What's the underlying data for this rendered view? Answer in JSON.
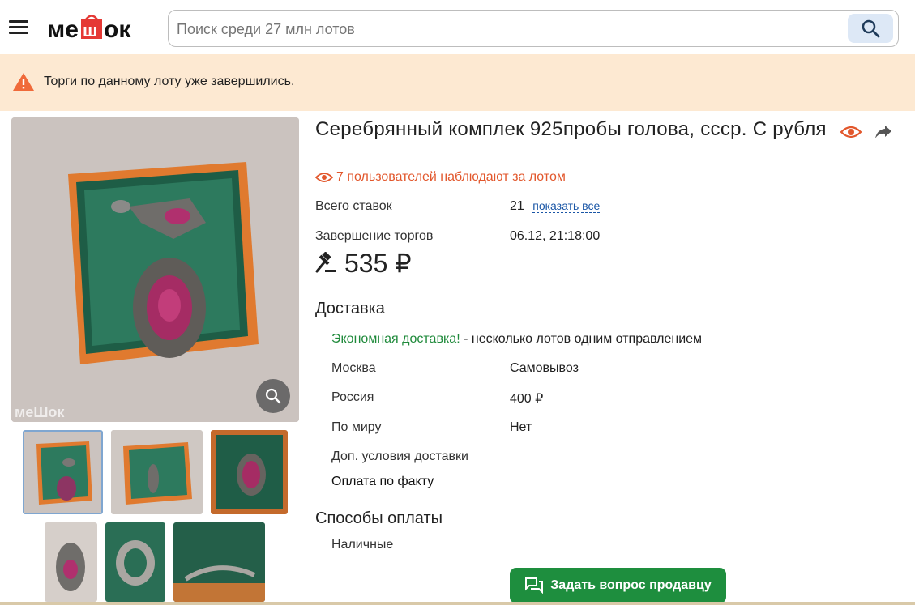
{
  "header": {
    "logo_text": "МЕШОК",
    "search_placeholder": "Поиск среди 27 млн лотов"
  },
  "notice": {
    "text": "Торги по данному лоту уже завершились."
  },
  "lot": {
    "title": "Серебрянный комплек 925пробы голова, ссср. С рубля",
    "watchers": "7 пользователей наблюдают за лотом",
    "bids_label": "Всего ставок",
    "bids_value": "21",
    "show_all": "показать все",
    "end_label": "Завершение торгов",
    "end_value": "06.12, 21:18:00",
    "price": "535 ₽"
  },
  "delivery": {
    "heading": "Доставка",
    "economy_link": "Экономная доставка!",
    "economy_text": " - несколько лотов одним отправлением",
    "rows": [
      {
        "label": "Москва",
        "value": "Самовывоз"
      },
      {
        "label": "Россия",
        "value": "400 ₽"
      },
      {
        "label": "По миру",
        "value": "Нет"
      }
    ],
    "extra_label": "Доп. условия доставки",
    "extra_value": "Оплата по факту"
  },
  "payment": {
    "heading": "Способы оплаты",
    "method": "Наличные"
  },
  "ask_button": "Задать вопрос продавцу",
  "colors": {
    "notice_bg": "#fde9d2",
    "accent_orange": "#e2572c",
    "green": "#1f8a3b",
    "button_green": "#1e8e3e",
    "link_blue": "#1a56a6"
  }
}
